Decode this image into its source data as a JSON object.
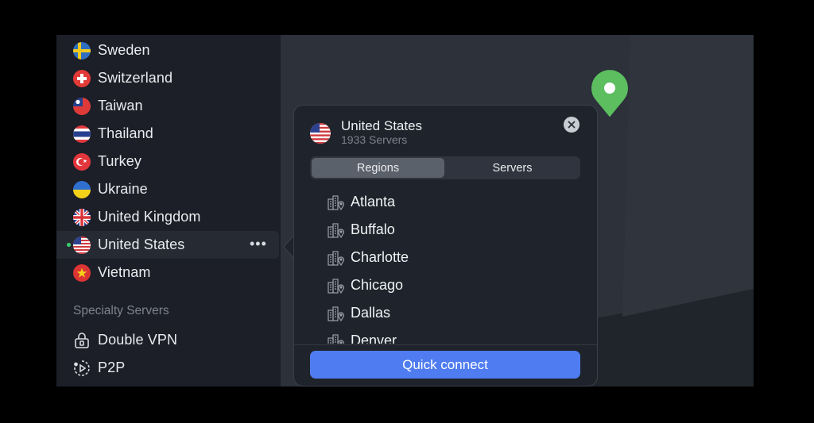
{
  "sidebar": {
    "countries": [
      {
        "label": "Sweden",
        "flag": "sweden-flag"
      },
      {
        "label": "Switzerland",
        "flag": "switzerland-flag"
      },
      {
        "label": "Taiwan",
        "flag": "taiwan-flag"
      },
      {
        "label": "Thailand",
        "flag": "thailand-flag"
      },
      {
        "label": "Turkey",
        "flag": "turkey-flag"
      },
      {
        "label": "Ukraine",
        "flag": "ukraine-flag"
      },
      {
        "label": "United Kingdom",
        "flag": "united-kingdom-flag"
      },
      {
        "label": "United States",
        "flag": "united-states-flag",
        "selected": true,
        "more": "•••"
      },
      {
        "label": "Vietnam",
        "flag": "vietnam-flag"
      }
    ],
    "specialty_title": "Specialty Servers",
    "specialty": [
      {
        "label": "Double VPN",
        "icon": "lock-icon"
      },
      {
        "label": "P2P",
        "icon": "p2p-icon"
      }
    ]
  },
  "popup": {
    "title": "United States",
    "subtitle": "1933 Servers",
    "tabs": [
      {
        "label": "Regions",
        "active": true
      },
      {
        "label": "Servers",
        "active": false
      }
    ],
    "regions": [
      "Atlanta",
      "Buffalo",
      "Charlotte",
      "Chicago",
      "Dallas",
      "Denver"
    ],
    "button_label": "Quick connect"
  },
  "colors": {
    "accent": "#4f7cf0",
    "pin": "#5cbe5f",
    "active_dot": "#3ecf6e"
  }
}
